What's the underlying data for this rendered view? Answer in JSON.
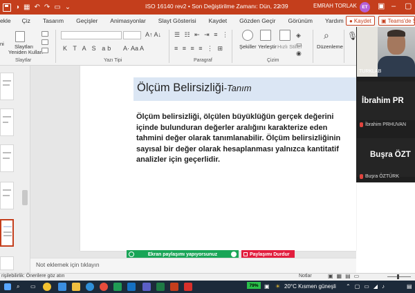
{
  "titlebar": {
    "document_title": "ISO 16140 rev2 • Son Değiştirilme Zamanı: Dün, 22:39",
    "user_name": "EMRAH TORLAK",
    "user_initials": "ET"
  },
  "ribbon_tabs": [
    "ekle",
    "Çiz",
    "Tasarım",
    "Geçişler",
    "Animasyonlar",
    "Slayt Gösterisi",
    "Kaydet",
    "Gözden Geçir",
    "Görünüm",
    "Yardım"
  ],
  "share": {
    "kaydet_label": "Kaydet",
    "teams_label": "Teams'de S"
  },
  "ribbon": {
    "slides_new_label": "Slaytları",
    "slides_reuse_label": "Yeniden Kullan",
    "group_slides": "Slaytlar",
    "group_font": "Yazı Tipi",
    "group_paragraph": "Paragraf",
    "group_drawing": "Çizim",
    "shapes_label": "Şekiller",
    "arrange_label": "Yerleştir",
    "quick_styles_label": "Hızlı Stiller",
    "editing_label": "Düzenleme",
    "font_buttons": "K  T  A  S  ab",
    "ni_label": "ni"
  },
  "slide": {
    "title_main": "Ölçüm Belirsizliği",
    "title_suffix": "-Tanım",
    "body": "Ölçüm belirsizliği, ölçülen büyüklüğün gerçek değerini içinde bulunduran değerler aralığını karakterize eden tahmini değer olarak tanımlanabilir. Ölçüm belirsizliğinin sayısal bir değer olarak hesaplanması yalnızca kantitatif analizler için geçerlidir."
  },
  "screenshare": {
    "status_label": "Ekran paylaşımı yapıyorsunuz",
    "stop_label": "Paylaşımı Durdur"
  },
  "notes_placeholder": "Not eklemek için tıklayın",
  "video": {
    "camera_label": "TURKLAB",
    "participant1_display": "İbrahim PR",
    "participant1_name": "İbrahim PRHUVAN",
    "participant2_display": "Buşra ÖZT",
    "participant2_name": "Buşra ÖZTÜRK"
  },
  "statusbar": {
    "accessibility": "rişilebilirlik: Önerilere göz atın",
    "notes": "Notlar"
  },
  "taskbar": {
    "battery": "79%",
    "weather": "20°C Kısmen güneşli"
  }
}
